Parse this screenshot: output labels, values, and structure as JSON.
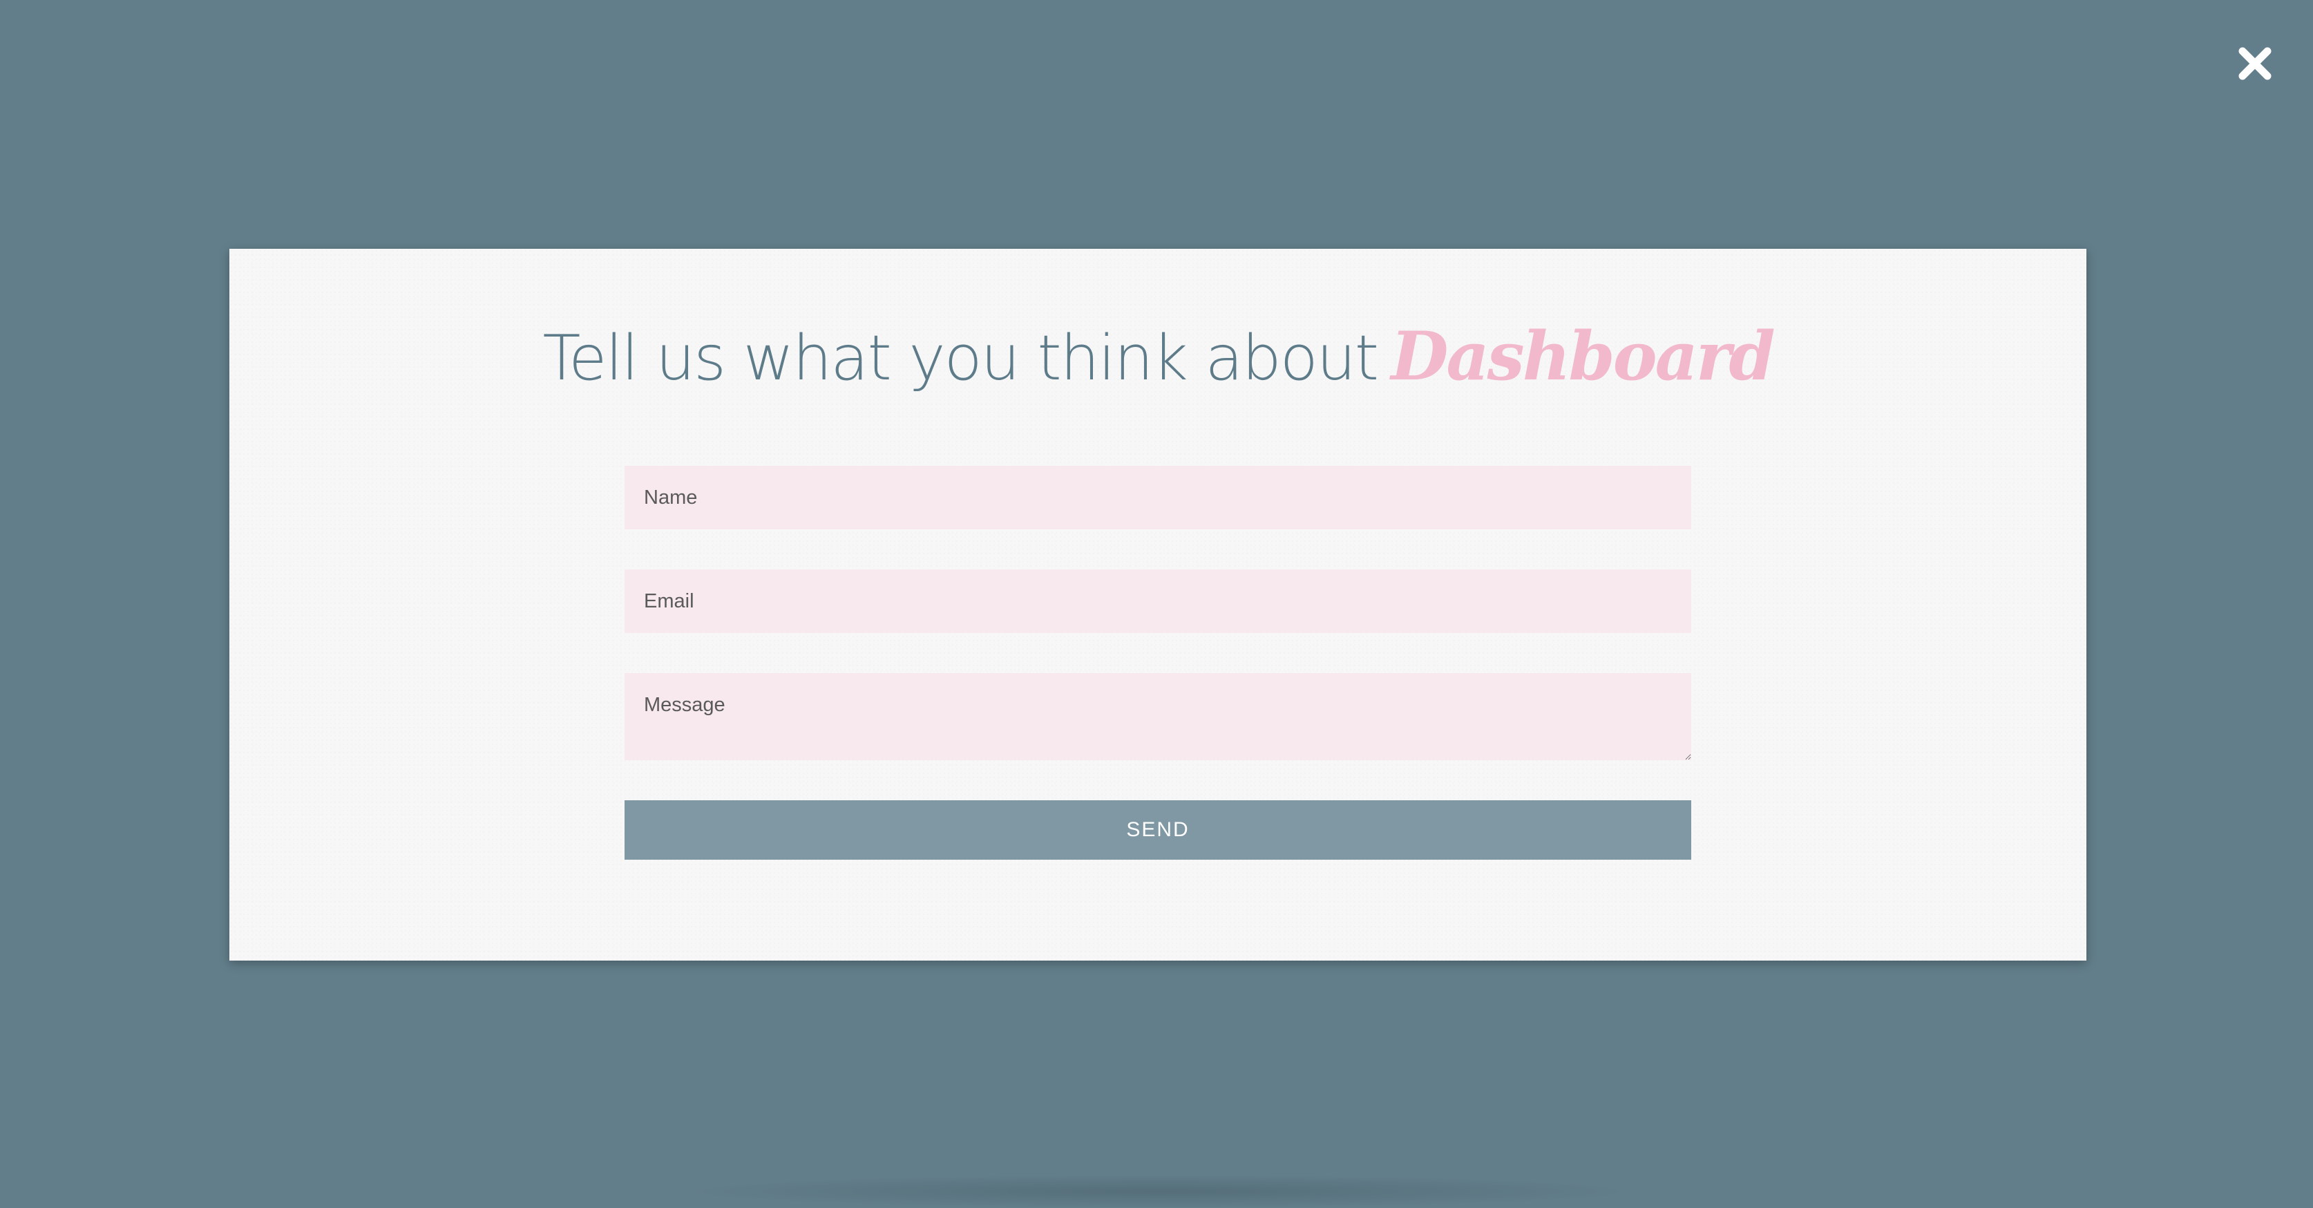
{
  "colors": {
    "backdrop": "#627e8a",
    "modal_background": "#f7f7f7",
    "title_text": "#5d7b89",
    "brand_accent": "#f2b8cc",
    "field_background": "#f8e9ee",
    "button_background": "#7f98a3",
    "button_text": "#ffffff"
  },
  "close_button": {
    "icon": "close-icon"
  },
  "modal": {
    "title_lead": "Tell us what you think about",
    "title_brand": "Dashboard",
    "form": {
      "name_placeholder": "Name",
      "name_value": "",
      "email_placeholder": "Email",
      "email_value": "",
      "message_placeholder": "Message",
      "message_value": "",
      "send_label": "SEND"
    }
  }
}
